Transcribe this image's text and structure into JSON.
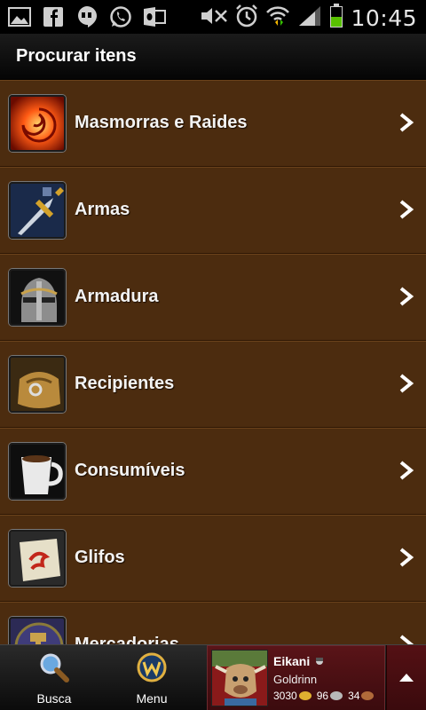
{
  "status_bar": {
    "left_icons": [
      "gallery-icon",
      "facebook-icon",
      "hangouts-icon",
      "whatsapp-icon",
      "outlook-icon"
    ],
    "right_icons": [
      "mute-icon",
      "alarm-icon",
      "wifi-icon",
      "signal-icon",
      "battery-icon"
    ],
    "time": "10:45"
  },
  "header": {
    "title": "Procurar itens"
  },
  "categories": [
    {
      "label": "Masmorras e Raides",
      "icon": "fire-swirl-icon"
    },
    {
      "label": "Armas",
      "icon": "sword-icon"
    },
    {
      "label": "Armadura",
      "icon": "helmet-icon"
    },
    {
      "label": "Recipientes",
      "icon": "bag-icon"
    },
    {
      "label": "Consumíveis",
      "icon": "mug-icon"
    },
    {
      "label": "Glifos",
      "icon": "scroll-icon"
    },
    {
      "label": "Mercadorias",
      "icon": "trade-goods-icon"
    }
  ],
  "bottom_nav": {
    "search_label": "Busca",
    "menu_label": "Menu"
  },
  "character": {
    "name": "Eikani",
    "realm": "Goldrinn",
    "gold": "3030",
    "silver": "96",
    "copper": "34"
  },
  "colors": {
    "list_background": "#4c2c0f",
    "header_background": "#0b0b0b",
    "character_background": "#4a0f13"
  }
}
